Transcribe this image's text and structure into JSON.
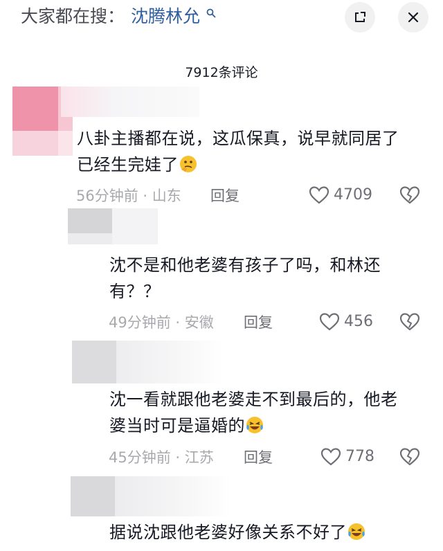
{
  "search": {
    "prefix": "大家都在搜：",
    "keyword": "沈腾林允"
  },
  "comment_count": "7912条评论",
  "colors": {
    "accent_link": "#2f5f9e",
    "meta_gray": "#a8a9ad",
    "avatar_pink": "#ef8fa8"
  },
  "icons": [
    "search-icon",
    "expand-icon",
    "close-icon",
    "heart-icon",
    "broken-heart-icon",
    "thinking-face-emoji",
    "laughing-crying-emoji"
  ],
  "comments": [
    {
      "line1": "八卦主播都在说，这瓜保真，说早就同居了",
      "line2": "已经生完娃了",
      "time": "56分钟前",
      "location": "山东",
      "reply": "回复",
      "likes": "4709"
    },
    {
      "line1": "沈不是和他老婆有孩子了吗，和林还",
      "line2": "有？？",
      "time": "49分钟前",
      "location": "安徽",
      "reply": "回复",
      "likes": "456"
    },
    {
      "line1": "沈一看就跟他老婆走不到最后的，他老",
      "line2": "婆当时可是逼婚的",
      "time": "45分钟前",
      "location": "江苏",
      "reply": "回复",
      "likes": "778"
    },
    {
      "line1": "据说沈跟他老婆好像关系不好了"
    }
  ]
}
